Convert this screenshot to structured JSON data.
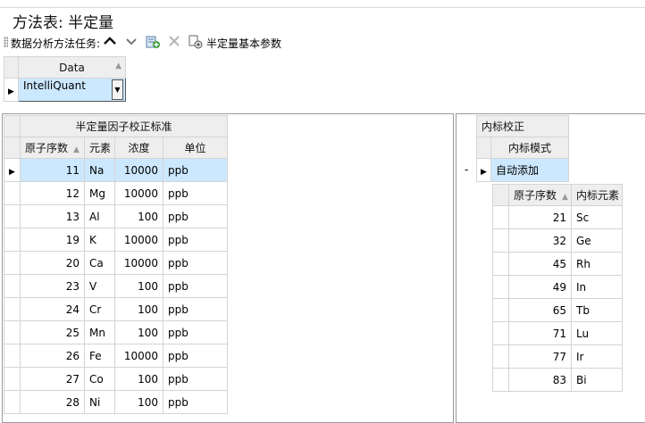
{
  "window": {
    "title": "方法表: 半定量"
  },
  "toolbar": {
    "task_label": "数据分析方法任务:",
    "params_label": "半定量基本参数",
    "icons": [
      "chevron-up-icon",
      "chevron-down-icon",
      "add-icon",
      "delete-icon",
      "settings-icon"
    ]
  },
  "data_grid": {
    "header": "Data",
    "value": "IntelliQuant"
  },
  "left_table": {
    "group_header": "半定量因子校正标准",
    "columns": [
      "原子序数",
      "元素",
      "浓度",
      "单位"
    ],
    "rows": [
      {
        "atomic": "11",
        "element": "Na",
        "conc": "10000",
        "unit": "ppb"
      },
      {
        "atomic": "12",
        "element": "Mg",
        "conc": "10000",
        "unit": "ppb"
      },
      {
        "atomic": "13",
        "element": "Al",
        "conc": "100",
        "unit": "ppb"
      },
      {
        "atomic": "19",
        "element": "K",
        "conc": "10000",
        "unit": "ppb"
      },
      {
        "atomic": "20",
        "element": "Ca",
        "conc": "10000",
        "unit": "ppb"
      },
      {
        "atomic": "23",
        "element": "V",
        "conc": "100",
        "unit": "ppb"
      },
      {
        "atomic": "24",
        "element": "Cr",
        "conc": "100",
        "unit": "ppb"
      },
      {
        "atomic": "25",
        "element": "Mn",
        "conc": "100",
        "unit": "ppb"
      },
      {
        "atomic": "26",
        "element": "Fe",
        "conc": "10000",
        "unit": "ppb"
      },
      {
        "atomic": "27",
        "element": "Co",
        "conc": "100",
        "unit": "ppb"
      },
      {
        "atomic": "28",
        "element": "Ni",
        "conc": "100",
        "unit": "ppb"
      }
    ]
  },
  "right_table": {
    "group_header": "内标校正",
    "mode_header": "内标模式",
    "mode_value": "自动添加",
    "collapse_symbol": "-",
    "columns": [
      "原子序数",
      "内标元素"
    ],
    "rows": [
      {
        "atomic": "21",
        "element": "Sc"
      },
      {
        "atomic": "32",
        "element": "Ge"
      },
      {
        "atomic": "45",
        "element": "Rh"
      },
      {
        "atomic": "49",
        "element": "In"
      },
      {
        "atomic": "65",
        "element": "Tb"
      },
      {
        "atomic": "71",
        "element": "Lu"
      },
      {
        "atomic": "77",
        "element": "Ir"
      },
      {
        "atomic": "83",
        "element": "Bi"
      }
    ]
  }
}
